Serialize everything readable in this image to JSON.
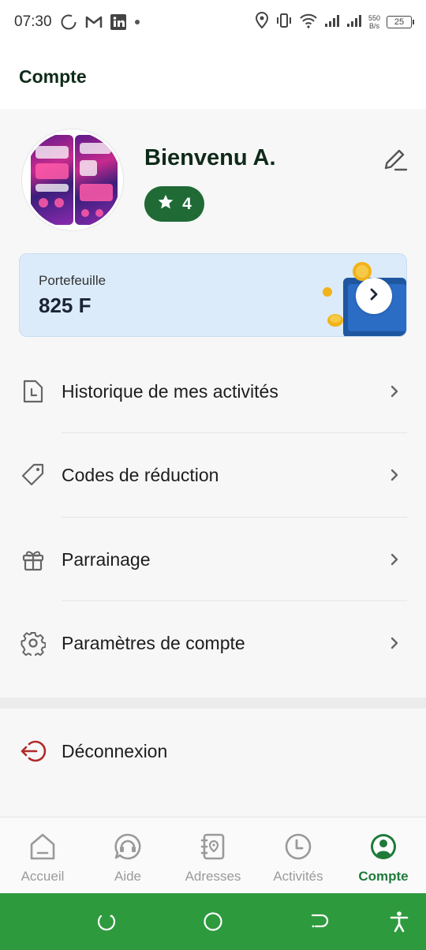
{
  "status_bar": {
    "time": "07:30",
    "net_speed_value": "550",
    "net_speed_unit": "B/s",
    "battery": "25"
  },
  "header": {
    "title": "Compte"
  },
  "profile": {
    "name": "Bienvenu A.",
    "rating": "4"
  },
  "wallet": {
    "label": "Portefeuille",
    "balance": "825 F"
  },
  "menu": {
    "items": [
      {
        "label": "Historique de mes activités",
        "icon": "history-icon"
      },
      {
        "label": "Codes de réduction",
        "icon": "tag-icon"
      },
      {
        "label": "Parrainage",
        "icon": "gift-icon"
      },
      {
        "label": "Paramètres de compte",
        "icon": "gear-icon"
      }
    ],
    "logout": "Déconnexion"
  },
  "bottom_nav": {
    "tabs": [
      {
        "label": "Accueil",
        "icon": "home-icon"
      },
      {
        "label": "Aide",
        "icon": "help-chat-icon"
      },
      {
        "label": "Adresses",
        "icon": "address-book-icon"
      },
      {
        "label": "Activités",
        "icon": "clock-icon"
      },
      {
        "label": "Compte",
        "icon": "account-icon"
      }
    ],
    "active": "Compte"
  },
  "colors": {
    "brand_green": "#1f6a35",
    "active_tab": "#1f7a3a",
    "system_nav": "#2e9a3e",
    "wallet_bg": "#dcebfa",
    "logout_icon": "#b02a2a"
  }
}
